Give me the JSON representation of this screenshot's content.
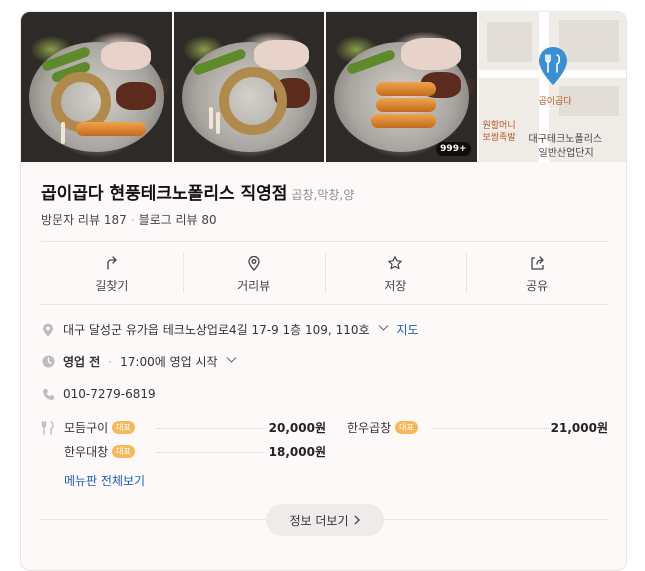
{
  "place": {
    "name": "곱이곱다 현풍테크노폴리스 직영점",
    "category": "곱창,막창,양",
    "visitor_reviews": "방문자 리뷰 187",
    "blog_reviews": "블로그 리뷰 80"
  },
  "photos": {
    "count_badge": "999+",
    "map_pin_label": "곱이곱다",
    "map_labels": [
      "원할머니",
      "보쌈족발",
      "대구테크노폴리스",
      "일반산업단지"
    ]
  },
  "actions": [
    {
      "label": "길찾기",
      "icon": "directions-icon"
    },
    {
      "label": "거리뷰",
      "icon": "location-pin-icon"
    },
    {
      "label": "저장",
      "icon": "star-icon"
    },
    {
      "label": "공유",
      "icon": "share-icon"
    }
  ],
  "info": {
    "address": "대구 달성군 유가읍 테크노상업로4길 17-9 1층 109, 110호",
    "map_link": "지도",
    "status": "영업 전",
    "hours": "17:00에 영업 시작",
    "phone": "010-7279-6819"
  },
  "menu": {
    "items": [
      {
        "name": "모듬구이",
        "tag": "대표",
        "price": "20,000원"
      },
      {
        "name": "한우곱창",
        "tag": "대표",
        "price": "21,000원"
      },
      {
        "name": "한우대창",
        "tag": "대표",
        "price": "18,000원"
      }
    ],
    "full_menu_link": "메뉴판 전체보기"
  },
  "more_info": "정보 더보기",
  "colors": {
    "accent": "#f4b95c",
    "link": "#1f5fb4",
    "card_bg": "#fcf9f8",
    "map_pin": "#3b8fd0"
  }
}
